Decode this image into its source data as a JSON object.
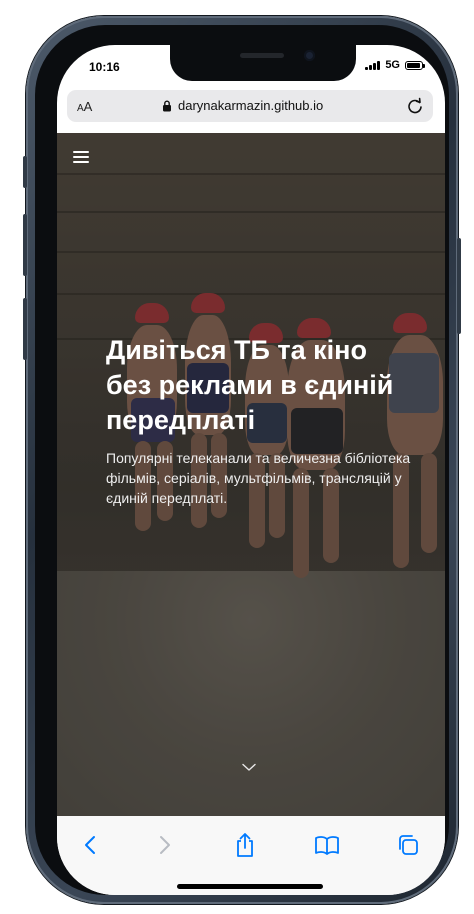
{
  "status_bar": {
    "time": "10:16",
    "network": "5G",
    "battery_level": 0.9
  },
  "browser": {
    "text_size_label": "AA",
    "url": "darynakarmazin.github.io",
    "icons": {
      "text_size": "aa-text-size-icon",
      "lock": "lock-icon",
      "reload": "reload-icon"
    }
  },
  "hero": {
    "menu_icon": "hamburger-menu-icon",
    "title": "Дивіться ТБ та кіно без реклами в єдиній передплаті",
    "subtitle": "Популярні телеканали та величезна бібліотека фільмів, серіалів, мультфільмів, трансляцій у єдиній передплаті.",
    "scroll_icon": "chevron-down-icon"
  },
  "toolbar": {
    "icons": [
      "back-icon",
      "forward-icon",
      "share-icon",
      "bookmarks-icon",
      "tabs-icon"
    ],
    "accent_color": "#007aff",
    "disabled_color": "#b8bcc3"
  }
}
